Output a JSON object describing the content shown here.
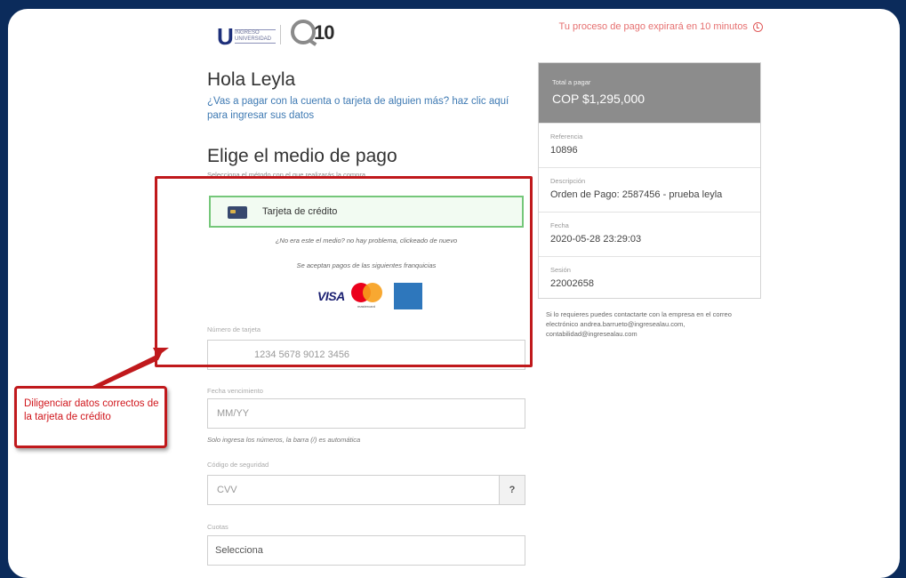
{
  "header": {
    "logo_u_letter": "U",
    "logo_u_text": "INGRESO UNIVERSIDAD",
    "logo_q_text": "10",
    "timer_text": "Tu proceso de pago expirará en 10 minutos"
  },
  "payer": {
    "greeting": "Hola Leyla",
    "other_account_link": "¿Vas a pagar con la cuenta o tarjeta de alguien más? haz clic aquí para ingresar sus datos"
  },
  "method_section": {
    "title": "Elige el medio de pago",
    "subtitle": "Selecciona el método con el que realizarás la compra",
    "selected_method": "Tarjeta de crédito",
    "not_method_text": "¿No era este el medio? no hay problema, clickeado de nuevo",
    "accepted_text": "Se aceptan pagos de las siguientes franquicias",
    "brands": [
      "VISA",
      "mastercard",
      "AMERICAN EXPRESS"
    ]
  },
  "form": {
    "card_number_label": "Número de tarjeta",
    "card_number_placeholder": "1234 5678 9012 3456",
    "expiry_label": "Fecha vencimiento",
    "expiry_placeholder": "MM/YY",
    "expiry_hint": "Solo ingresa los números, la barra (/) es automática",
    "cvv_label": "Código de seguridad",
    "cvv_placeholder": "CVV",
    "cvv_help": "?",
    "installments_label": "Cuotas",
    "installments_value": "Selecciona"
  },
  "summary": {
    "total_label": "Total a pagar",
    "total_value": "COP $1,295,000",
    "rows": [
      {
        "label": "Referencia",
        "value": "10896"
      },
      {
        "label": "Descripción",
        "value": "Orden de Pago: 2587456 - prueba leyla"
      },
      {
        "label": "Fecha",
        "value": "2020-05-28 23:29:03"
      },
      {
        "label": "Sesión",
        "value": "22002658"
      }
    ],
    "contact_text": "Si lo requieres puedes contactarte con la empresa en el correo electrónico andrea.barrueto@ingresealau.com, contabilidad@ingresealau.com"
  },
  "annotation": {
    "callout_text": "Diligenciar datos correctos de la tarjeta de crédito",
    "color": "#c0191c"
  }
}
